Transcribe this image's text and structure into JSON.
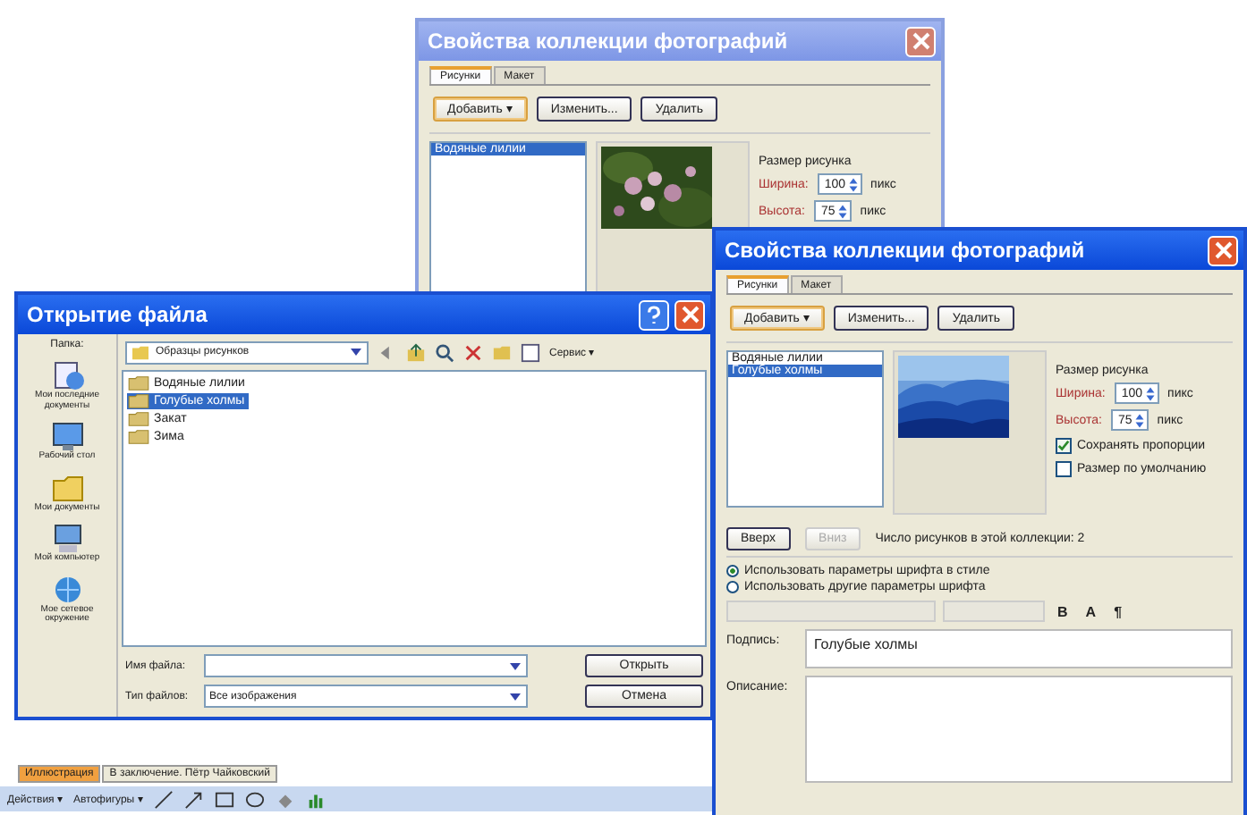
{
  "back_dialog": {
    "title": "Свойства коллекции фотографий",
    "tabs": [
      {
        "label": "Рисунки",
        "selected": true
      },
      {
        "label": "Макет",
        "selected": false
      }
    ],
    "buttons": [
      "Добавить ▾",
      "Изменить...",
      "Удалить"
    ],
    "list_items": [
      {
        "label": "Водяные лилии",
        "selected": true
      }
    ],
    "picture": {
      "kind": "picture"
    },
    "size_heading": "Размер рисунка",
    "size_fields": [
      {
        "label": "Ширина:",
        "value": "100",
        "unit": "пикс"
      },
      {
        "label": "Высота:",
        "value": "75",
        "unit": "пикс"
      }
    ]
  },
  "open_dialog": {
    "title": "Открытие файла",
    "folder_label": "Папка:",
    "folder": "Образцы рисунков",
    "tools_label": "Сервис ▾",
    "places": [
      {
        "label": "Мои последние документы",
        "kind": "recent"
      },
      {
        "label": "Рабочий стол",
        "kind": "desktop"
      },
      {
        "label": "Мои документы",
        "kind": "documents"
      },
      {
        "label": "Мой компьютер",
        "kind": "computer"
      },
      {
        "label": "Мое сетевое окружение",
        "kind": "network"
      }
    ],
    "files": [
      {
        "name": "Водяные лилии",
        "selected": false
      },
      {
        "name": "Голубые холмы",
        "selected": true
      },
      {
        "name": "Закат",
        "selected": false
      },
      {
        "name": "Зима",
        "selected": false
      }
    ],
    "file_name_label": "Имя файла:",
    "file_type_label": "Тип файлов:",
    "file_type": "Все изображения",
    "buttons": [
      "Открыть",
      "Отмена"
    ]
  },
  "front_dialog": {
    "title": "Свойства коллекции фотографий",
    "tabs": [
      {
        "label": "Рисунки",
        "selected": true
      },
      {
        "label": "Макет",
        "selected": false
      }
    ],
    "buttons": [
      "Добавить ▾",
      "Изменить...",
      "Удалить"
    ],
    "list_items": [
      {
        "label": "Водяные лилии",
        "selected": false
      },
      {
        "label": "Голубые холмы",
        "selected": true
      }
    ],
    "picture": {
      "kind": "picture"
    },
    "size_heading": "Размер рисунка",
    "size_fields": [
      {
        "label": "Ширина:",
        "value": "100",
        "unit": "пикс"
      },
      {
        "label": "Высота:",
        "value": "75",
        "unit": "пикс"
      }
    ],
    "options": [
      {
        "label": "Сохранять пропорции",
        "checked": true
      },
      {
        "label": "Размер по умолчанию",
        "checked": false
      }
    ],
    "move_buttons": [
      {
        "label": "Вверх",
        "disabled": false
      },
      {
        "label": "Вниз",
        "disabled": true
      }
    ],
    "count_text": "Число рисунков в этой коллекции: 2",
    "font_modes": [
      {
        "label": "Использовать параметры шрифта в стиле",
        "selected": true
      },
      {
        "label": "Использовать другие параметры шрифта",
        "selected": false
      }
    ],
    "format_buttons": [
      "B",
      "A",
      "¶"
    ],
    "caption_label": "Подпись:",
    "caption": "Голубые холмы",
    "description_label": "Описание:"
  },
  "slide_tabs": [
    {
      "label": "Иллюстрация",
      "selected": true
    },
    {
      "label": "В заключение. Пётр Чайковский",
      "selected": false
    }
  ],
  "drawing_toolbar": {
    "actions": "Действия ▾",
    "autoshapes": "Автофигуры ▾"
  }
}
